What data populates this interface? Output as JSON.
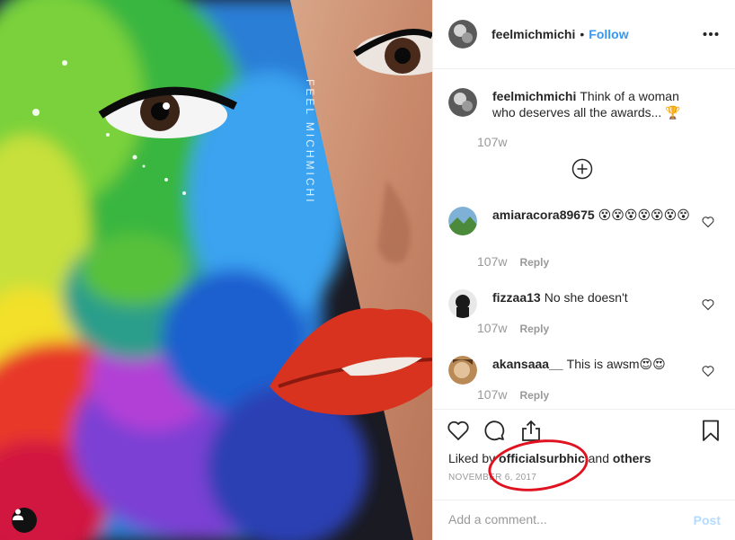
{
  "post": {
    "watermark": "FEEL MICHMICHI",
    "author": "feelmichmichi",
    "separator": "•",
    "follow_label": "Follow"
  },
  "caption": {
    "username": "feelmichmichi",
    "text": "Think of a woman who deserves all the awards... 🏆",
    "age": "107w"
  },
  "comments": [
    {
      "username": "amiaracora89675",
      "text": "😵😵😵😵😵😵😵",
      "age": "107w",
      "reply_label": "Reply"
    },
    {
      "username": "fizzaa13",
      "text": "No she doesn't",
      "age": "107w",
      "reply_label": "Reply"
    },
    {
      "username": "akansaaa__",
      "text": "This is awsm😍😍",
      "age": "107w",
      "reply_label": "Reply"
    }
  ],
  "likes": {
    "prefix": "Liked by",
    "user": "officialsurbhic",
    "joiner": "and",
    "others": "others"
  },
  "date": "NOVEMBER 6, 2017",
  "add_comment": {
    "placeholder": "Add a comment...",
    "post_label": "Post"
  },
  "colors": {
    "link": "#3897f0",
    "annotation": "#e0121f",
    "post_disabled": "#b3dbff"
  }
}
